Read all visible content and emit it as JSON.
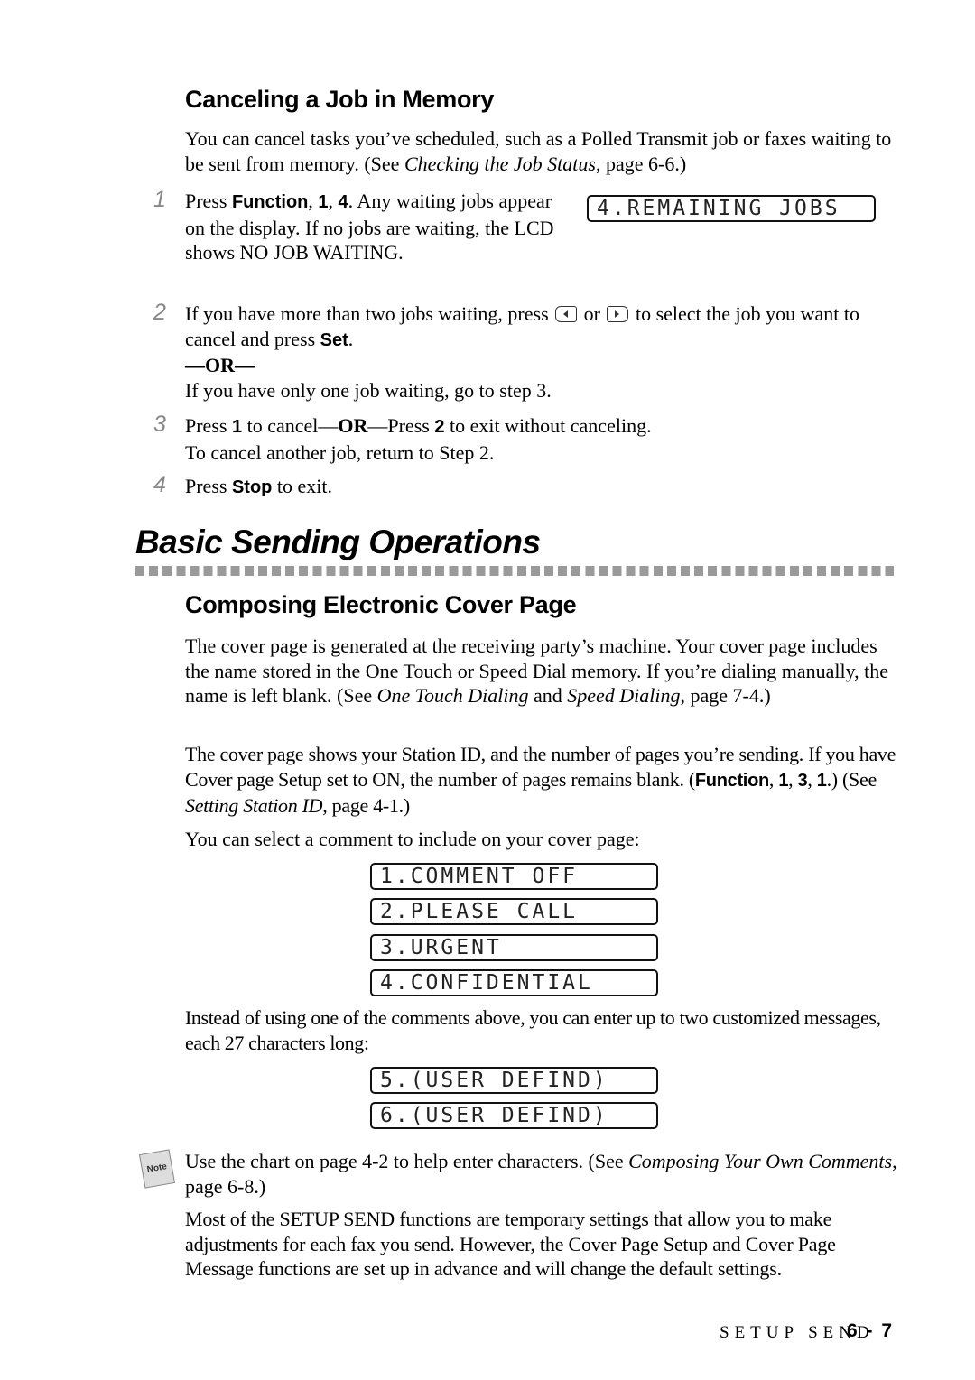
{
  "section1": {
    "heading": "Canceling a Job in Memory",
    "intro": {
      "t1": "You can cancel tasks you’ve scheduled, such as a Polled Transmit job or faxes waiting to be sent from memory. (See ",
      "ref": "Checking the Job Status",
      "t2": ", page 6-6.)"
    },
    "steps": [
      {
        "num": "1",
        "p1": "Press ",
        "k1": "Function",
        "p2": ", ",
        "k2": "1",
        "p3": ", ",
        "k3": "4",
        "p4": ". Any waiting jobs appear on the display. If no jobs are waiting, the LCD shows NO JOB WAITING."
      },
      {
        "num": "2",
        "p1": "If you have more than two jobs waiting, press ",
        "or_word": " or ",
        "p2": " to select the job you want to cancel and press ",
        "k1": "Set",
        "p3": ".",
        "or_line": "—OR—",
        "alt": "If you have only one job waiting, go to step 3."
      },
      {
        "num": "3",
        "p1": "Press ",
        "k1": "1",
        "p2": " to cancel—",
        "or": "OR",
        "p3": "—Press ",
        "k2": "2",
        "p4": " to exit without canceling.",
        "line2": "To cancel another job, return to Step 2."
      },
      {
        "num": "4",
        "p1": "Press ",
        "k1": "Stop",
        "p2": " to exit."
      }
    ],
    "lcd": "4.REMAINING JOBS"
  },
  "chapter_title": "Basic Sending Operations",
  "section2": {
    "heading": "Composing Electronic Cover Page",
    "para1": {
      "t1": "The cover page is generated at the receiving party’s machine. Your cover page includes the name stored in the One Touch or Speed Dial memory. If you’re dialing manually, the name is left blank. (See ",
      "ref1": "One Touch Dialing",
      "t2": " and ",
      "ref2": "Speed Dialing",
      "t3": ", page 7-4.)"
    },
    "para2": {
      "t1": "The cover page shows your Station ID, and the number of pages you’re sending. If you have Cover page Setup set to ON, the number of pages remains blank. (",
      "k1": "Function",
      "t2": ", ",
      "k2": "1",
      "t3": ", ",
      "k3": "3",
      "t4": ", ",
      "k4": "1",
      "t5": ".) (See ",
      "ref": "Setting Station ID",
      "t6": ", page 4-1.)"
    },
    "para3": "You can select a comment to include on your cover page:",
    "comments": [
      "1.COMMENT OFF",
      "2.PLEASE CALL",
      "3.URGENT",
      "4.CONFIDENTIAL"
    ],
    "para4": "Instead of using one of the comments above, you can enter up to two customized messages, each 27 characters long:",
    "custom": [
      "5.(USER DEFIND)",
      "6.(USER DEFIND)"
    ],
    "note_label": "Note",
    "note": {
      "t1": "Use the chart on page 4-2 to help enter characters. (See ",
      "ref": "Composing Your Own Comments",
      "t2": ", page 6-8.)"
    },
    "para5": "Most of the SETUP SEND functions are temporary settings that allow you to make adjustments for each fax you send. However, the Cover Page Setup and Cover Page Message functions are set up in advance and will change the default settings."
  },
  "footer": {
    "section": "SETUP SEND",
    "page": "6-7"
  }
}
